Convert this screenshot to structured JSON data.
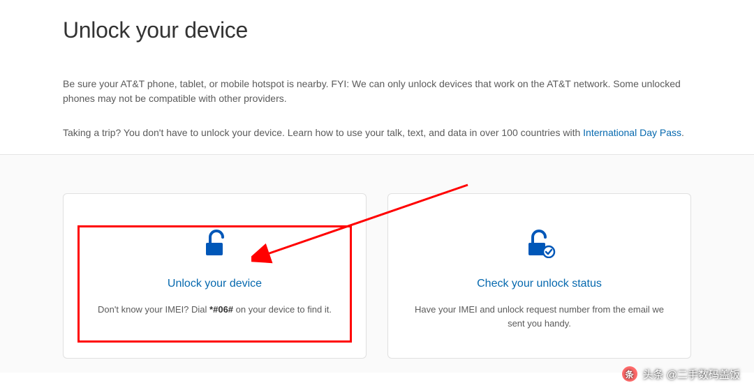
{
  "header": {
    "title": "Unlock your device",
    "intro": "Be sure your AT&T phone, tablet, or mobile hotspot is nearby. FYI: We can only unlock devices that work on the AT&T network. Some unlocked phones may not be compatible with other providers.",
    "trip_prefix": "Taking a trip? You don't have to unlock your device. Learn how to use your talk, text, and data in over 100 countries with ",
    "trip_link": "International Day Pass",
    "trip_suffix": "."
  },
  "cards": {
    "unlock": {
      "title": "Unlock your device",
      "desc_prefix": "Don't know your IMEI? Dial ",
      "desc_bold": "*#06#",
      "desc_suffix": " on your device to find it."
    },
    "status": {
      "title": "Check your unlock status",
      "desc": "Have your IMEI and unlock request number from the email we sent you handy."
    }
  },
  "watermark": {
    "text": "头条 @二手数码盖饭"
  },
  "colors": {
    "link": "#0568ae",
    "highlight": "#ff0000",
    "brand_blue": "#0057b8"
  }
}
